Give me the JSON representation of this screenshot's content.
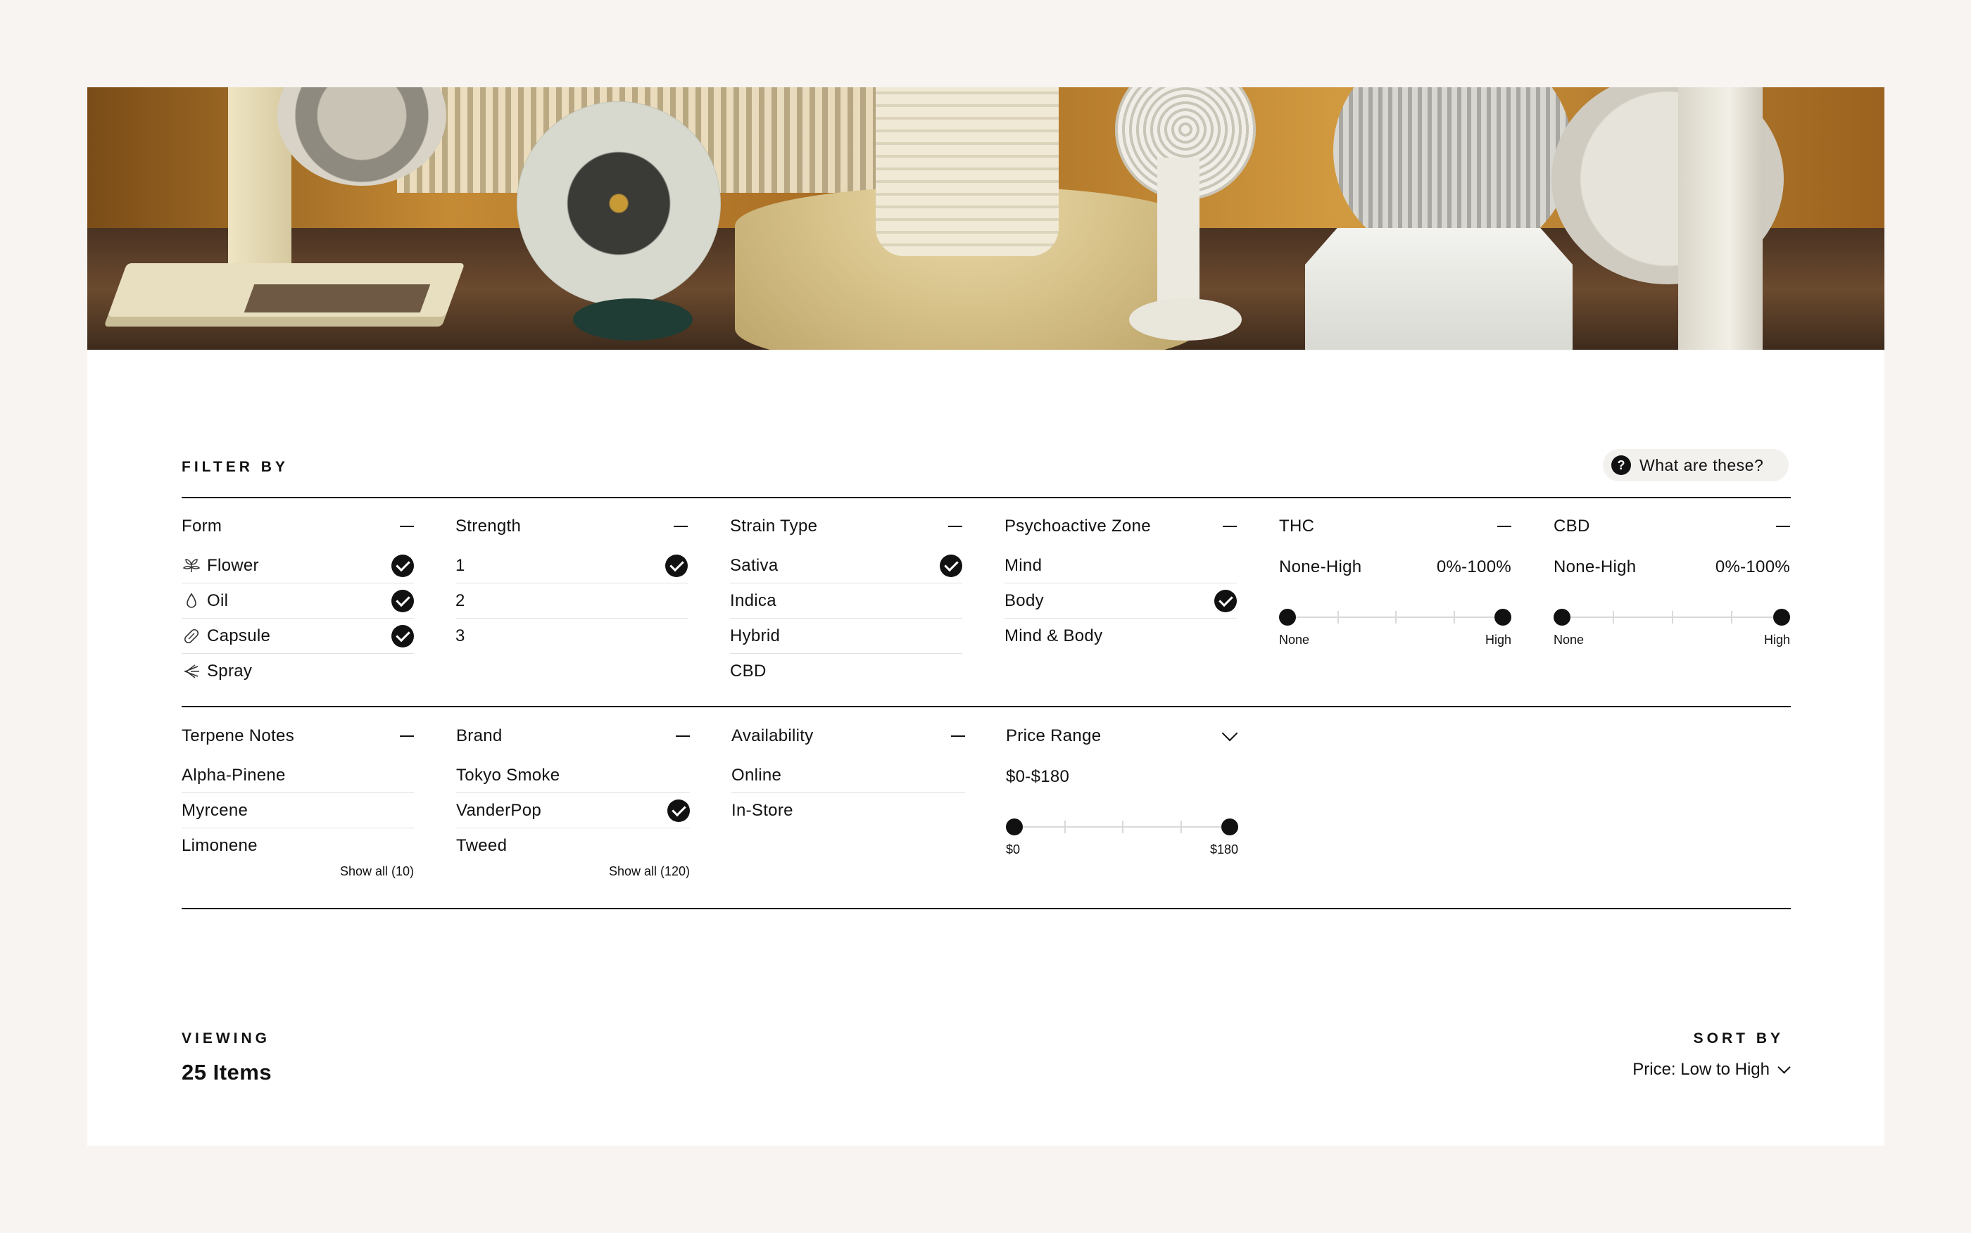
{
  "filter_label": "FILTER BY",
  "help_label": "What are these?",
  "groups_row1": {
    "form": {
      "title": "Form",
      "options": [
        {
          "label": "Flower",
          "icon": "leaf-icon",
          "checked": true
        },
        {
          "label": "Oil",
          "icon": "drop-icon",
          "checked": true
        },
        {
          "label": "Capsule",
          "icon": "capsule-icon",
          "checked": true
        },
        {
          "label": "Spray",
          "icon": "spray-icon",
          "checked": false
        }
      ]
    },
    "strength": {
      "title": "Strength",
      "options": [
        {
          "label": "1",
          "checked": true
        },
        {
          "label": "2",
          "checked": false
        },
        {
          "label": "3",
          "checked": false
        }
      ]
    },
    "strain": {
      "title": "Strain Type",
      "options": [
        {
          "label": "Sativa",
          "checked": true
        },
        {
          "label": "Indica",
          "checked": false
        },
        {
          "label": "Hybrid",
          "checked": false
        },
        {
          "label": "CBD",
          "checked": false
        }
      ]
    },
    "zone": {
      "title": "Psychoactive Zone",
      "options": [
        {
          "label": "Mind",
          "checked": false
        },
        {
          "label": "Body",
          "checked": true
        },
        {
          "label": "Mind & Body",
          "checked": false
        }
      ]
    },
    "thc": {
      "title": "THC",
      "range_label": "None-High",
      "range_value": "0%-100%",
      "min_label": "None",
      "max_label": "High",
      "low": 0,
      "high": 1
    },
    "cbd": {
      "title": "CBD",
      "range_label": "None-High",
      "range_value": "0%-100%",
      "min_label": "None",
      "max_label": "High",
      "low": 0,
      "high": 1
    }
  },
  "groups_row2": {
    "terpene": {
      "title": "Terpene Notes",
      "options": [
        {
          "label": "Alpha-Pinene",
          "checked": false
        },
        {
          "label": "Myrcene",
          "checked": false
        },
        {
          "label": "Limonene",
          "checked": false
        }
      ],
      "show_all": "Show all (10)"
    },
    "brand": {
      "title": "Brand",
      "options": [
        {
          "label": "Tokyo Smoke",
          "checked": false
        },
        {
          "label": "VanderPop",
          "checked": true
        },
        {
          "label": "Tweed",
          "checked": false
        }
      ],
      "show_all": "Show all (120)"
    },
    "availability": {
      "title": "Availability",
      "options": [
        {
          "label": "Online",
          "checked": false
        },
        {
          "label": "In-Store",
          "checked": false
        }
      ]
    },
    "price": {
      "title": "Price Range",
      "range_value": "$0-$180",
      "min_label": "$0",
      "max_label": "$180",
      "low": 0,
      "high": 1
    }
  },
  "viewing_label": "VIEWING",
  "viewing_count": "25 Items",
  "sort_label": "SORT BY",
  "sort_value": "Price: Low to High"
}
